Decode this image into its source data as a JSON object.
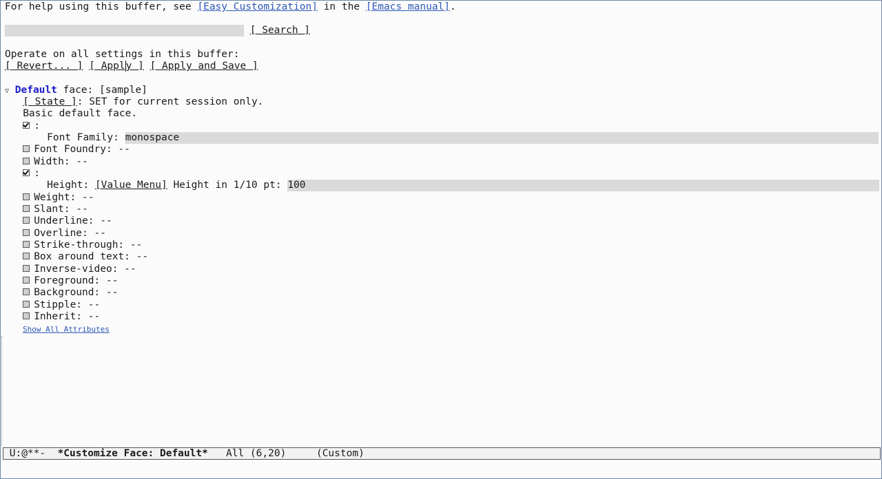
{
  "help": {
    "prefix": "For help using this buffer, see ",
    "link1": "[Easy Customization]",
    "middle": " in the ",
    "link2": "[Emacs manual]",
    "suffix": "."
  },
  "search": {
    "button": "[ Search ]"
  },
  "operate": {
    "label": "Operate on all settings in this buffer:",
    "revert": "[ Revert... ]",
    "apply_a": "[ Appl",
    "apply_b": "y ]",
    "apply_save": "[ Apply and Save ]"
  },
  "face": {
    "name": "Default",
    "label": " face: ",
    "sample": "[sample]",
    "state_button": "[ State ]",
    "state_text": ": SET for current session only.",
    "doc": "Basic default face."
  },
  "attributes": [
    {
      "checked": true,
      "label": ":"
    },
    {
      "checked": false,
      "label": "Font Foundry: --"
    },
    {
      "checked": false,
      "label": "Width: --"
    },
    {
      "checked": true,
      "label": ":"
    },
    {
      "checked": false,
      "label": "Weight: --"
    },
    {
      "checked": false,
      "label": "Slant: --"
    },
    {
      "checked": false,
      "label": "Underline: --"
    },
    {
      "checked": false,
      "label": "Overline: --"
    },
    {
      "checked": false,
      "label": "Strike-through: --"
    },
    {
      "checked": false,
      "label": "Box around text: --"
    },
    {
      "checked": false,
      "label": "Inverse-video: --"
    },
    {
      "checked": false,
      "label": "Foreground: --"
    },
    {
      "checked": false,
      "label": "Background: --"
    },
    {
      "checked": false,
      "label": "Stipple: --"
    },
    {
      "checked": false,
      "label": "Inherit: --"
    }
  ],
  "font_family": {
    "label": "Font Family: ",
    "value": "monospace"
  },
  "height": {
    "label": "Height: ",
    "menu": "[Value Menu]",
    "unit": " Height in 1/10 pt: ",
    "value": "100"
  },
  "show_all": "Show All Attributes",
  "modeline": {
    "status": "U:@**-  ",
    "buffer": "*Customize Face: Default*",
    "position": "   All (6,20)     (Custom)"
  },
  "colors": {
    "link": "#2d57b8",
    "face_name": "#1c1cc8",
    "field_bg": "#dadada"
  }
}
